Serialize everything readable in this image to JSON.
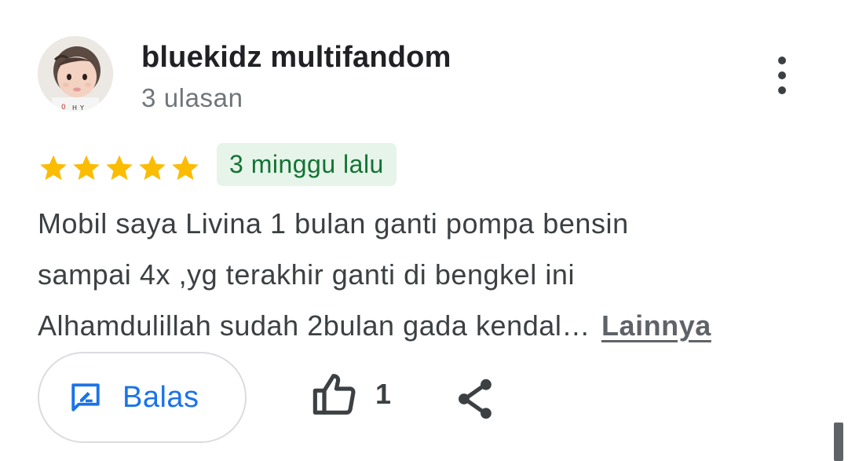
{
  "review": {
    "author_name": "bluekidz multifandom",
    "review_count": "3 ulasan",
    "avatar": "profile-photo",
    "more_options_icon": "more-vert-icon",
    "rating": 5,
    "max_rating": 5,
    "time_ago": "3 minggu lalu",
    "text_lines": [
      "Mobil saya Livina 1 bulan ganti pompa bensin",
      "sampai 4x ,yg terakhir ganti di bengkel ini",
      "Alhamdulillah sudah 2bulan gada kendal…"
    ],
    "more_link": "Lainnya"
  },
  "actions": {
    "reply_label": "Balas",
    "reply_icon": "rate-review-icon",
    "like_icon": "thumb-up-icon",
    "like_count": "1",
    "share_icon": "share-icon"
  },
  "colors": {
    "star": "#fbbc04",
    "badge_bg": "#e6f4ea",
    "badge_text": "#137333",
    "accent": "#1a73e8",
    "text_primary": "#202124",
    "text_secondary": "#70757a"
  }
}
